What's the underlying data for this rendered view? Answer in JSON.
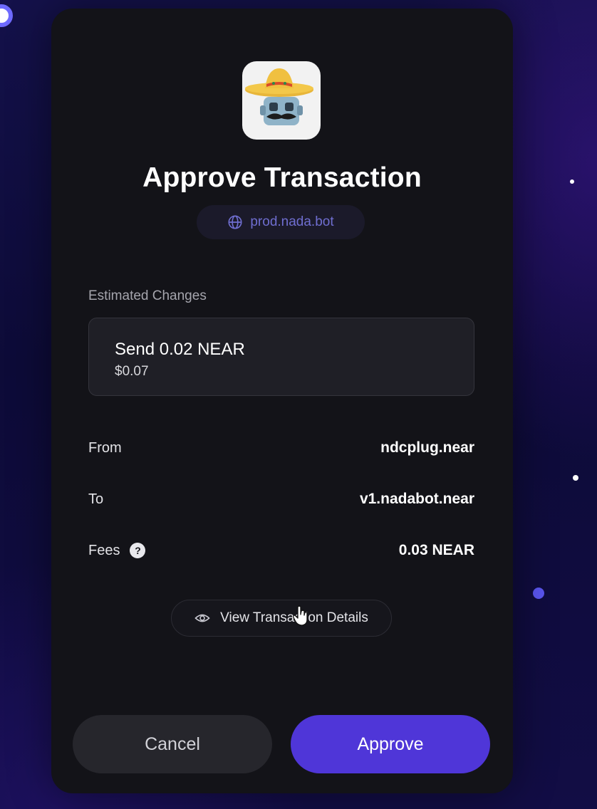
{
  "modal": {
    "app_icon": "sombrero-robot-icon",
    "title": "Approve Transaction",
    "origin": {
      "icon": "globe-icon",
      "label": "prod.nada.bot"
    },
    "estimated_changes": {
      "label": "Estimated Changes",
      "main": "Send 0.02 NEAR",
      "sub": "$0.07"
    },
    "details": {
      "from_label": "From",
      "from_value": "ndcplug.near",
      "to_label": "To",
      "to_value": "v1.nadabot.near",
      "fees_label": "Fees",
      "fees_value": "0.03 NEAR",
      "fees_help": "?"
    },
    "view_details_label": "View Transaction Details",
    "cancel_label": "Cancel",
    "approve_label": "Approve"
  },
  "colors": {
    "accent": "#4f36d8",
    "origin_text": "#6f6ed0",
    "modal_bg": "#131318"
  }
}
